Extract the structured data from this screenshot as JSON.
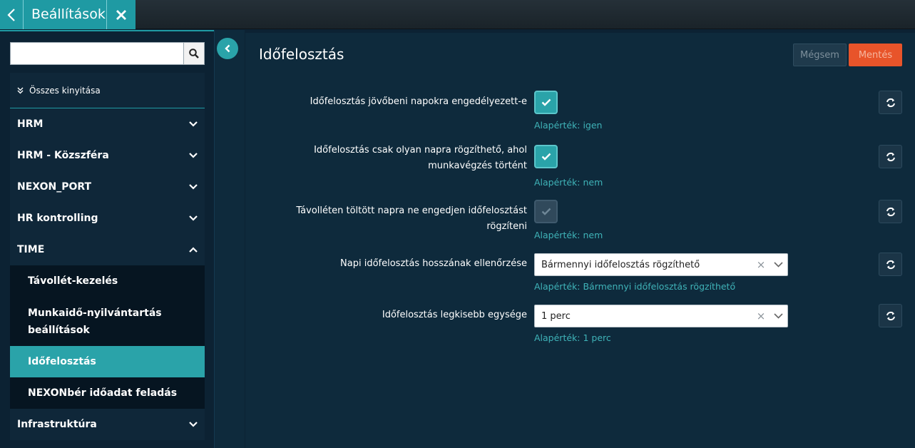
{
  "header": {
    "title": "Beállítások"
  },
  "sidebar": {
    "search": {
      "value": "",
      "placeholder": ""
    },
    "expand_all_label": "Összes kinyitása",
    "menu": [
      {
        "label": "HRM"
      },
      {
        "label": "HRM - Közszféra"
      },
      {
        "label": "NEXON_PORT"
      },
      {
        "label": "HR kontrolling"
      },
      {
        "label": "TIME"
      }
    ],
    "submenu": [
      {
        "label": "Távollét-kezelés"
      },
      {
        "label": "Munkaidő-nyilvántartás beállítások"
      },
      {
        "label": "Időfelosztás"
      },
      {
        "label": "NEXONbér időadat feladás"
      }
    ],
    "menu_after": [
      {
        "label": "Infrastruktúra"
      }
    ]
  },
  "main": {
    "title": "Időfelosztás",
    "cancel_label": "Mégsem",
    "save_label": "Mentés",
    "settings": [
      {
        "label": "Időfelosztás jövőbeni napokra engedélyezett-e",
        "checked": true,
        "default": "Alapérték: igen"
      },
      {
        "label": "Időfelosztás csak olyan napra rögzíthető, ahol munkavégzés történt",
        "checked": true,
        "default": "Alapérték: nem"
      },
      {
        "label": "Távolléten töltött napra ne engedjen időfelosztást rögzíteni",
        "checked": false,
        "default": "Alapérték: nem"
      },
      {
        "label": "Napi időfelosztás hosszának ellenőrzése",
        "select_value": "Bármennyi időfelosztás rögzíthető",
        "default": "Alapérték: Bármennyi időfelosztás rögzíthető"
      },
      {
        "label": "Időfelosztás legkisebb egysége",
        "select_value": "1 perc",
        "default": "Alapérték: 1 perc"
      }
    ]
  },
  "colors": {
    "accent": "#2aa3a9",
    "save": "#e8542a",
    "background": "#0e2a3c"
  }
}
